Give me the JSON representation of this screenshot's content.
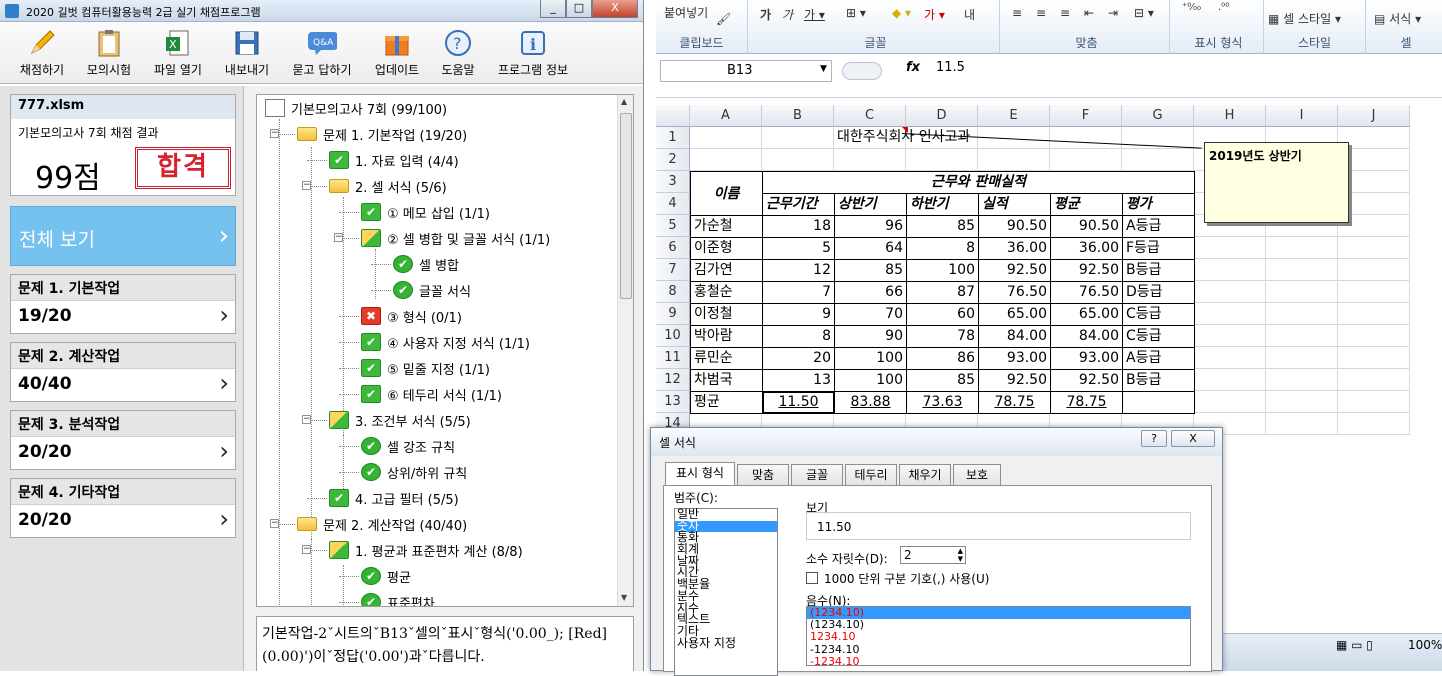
{
  "app": {
    "title": "2020 길벗 컴퓨터활용능력 2급 실기 채점프로그램",
    "window_controls": [
      "_",
      "□",
      "X"
    ],
    "toolbar": [
      {
        "label": "채점하기",
        "icon": "pencil-icon"
      },
      {
        "label": "모의시험",
        "icon": "clipboard-icon"
      },
      {
        "label": "파일 열기",
        "icon": "excel-file-icon"
      },
      {
        "label": "내보내기",
        "icon": "floppy-disk-icon"
      },
      {
        "label": "묻고 답하기",
        "icon": "qa-icon"
      },
      {
        "label": "업데이트",
        "icon": "gift-icon"
      },
      {
        "label": "도움말",
        "icon": "help-icon"
      },
      {
        "label": "프로그램 정보",
        "icon": "info-icon"
      }
    ],
    "result": {
      "file": "777.xlsm",
      "subtitle": "기본모의고사 7회 채점 결과",
      "score": "99점",
      "stamp": "합격"
    },
    "view_all": "전체 보기",
    "questions": [
      {
        "title": "문제 1. 기본작업",
        "score": "19/20"
      },
      {
        "title": "문제 2. 계산작업",
        "score": "40/40"
      },
      {
        "title": "문제 3. 분석작업",
        "score": "20/20"
      },
      {
        "title": "문제 4. 기타작업",
        "score": "20/20"
      }
    ],
    "tree": [
      {
        "label": "기본모의고사 7회 (99/100)",
        "icon": "doc"
      },
      {
        "label": "문제 1. 기본작업 (19/20)",
        "icon": "folder"
      },
      {
        "label": "1. 자료 입력 (4/4)",
        "icon": "ok"
      },
      {
        "label": "2. 셀 서식 (5/6)",
        "icon": "folder"
      },
      {
        "label": "① 메모 삽입 (1/1)",
        "icon": "ok"
      },
      {
        "label": "② 셀 병합 및 글꼴 서식 (1/1)",
        "icon": "okf"
      },
      {
        "label": "셀 병합",
        "icon": "circle"
      },
      {
        "label": "글꼴 서식",
        "icon": "circle"
      },
      {
        "label": "③ 형식 (0/1)",
        "icon": "x"
      },
      {
        "label": "④ 사용자 지정 서식 (1/1)",
        "icon": "ok"
      },
      {
        "label": "⑤ 밑줄 지정 (1/1)",
        "icon": "ok"
      },
      {
        "label": "⑥ 테두리 서식 (1/1)",
        "icon": "ok"
      },
      {
        "label": "3. 조건부 서식 (5/5)",
        "icon": "okf"
      },
      {
        "label": "셀 강조 규칙",
        "icon": "circle"
      },
      {
        "label": "상위/하위 규칙",
        "icon": "circle"
      },
      {
        "label": "4. 고급 필터 (5/5)",
        "icon": "ok"
      },
      {
        "label": "문제 2. 계산작업 (40/40)",
        "icon": "folder"
      },
      {
        "label": "1. 평균과 표준편차 계산 (8/8)",
        "icon": "okf"
      },
      {
        "label": "평균",
        "icon": "circle"
      },
      {
        "label": "표준편차",
        "icon": "circle"
      }
    ],
    "message": "기본작업-2ˇ시트의ˇB13ˇ셀의ˇ표시ˇ형식('0.00_); [Red](0.00)')이ˇ정답('0.00')과ˇ다릅니다."
  },
  "excel": {
    "ribbon": {
      "paste_label": "붙여넣기",
      "groups": [
        "클립보드",
        "글꼴",
        "맞춤",
        "표시 형식",
        "스타일",
        "셀"
      ],
      "cell_style": "셀 스타일",
      "format": "서식"
    },
    "namebox": "B13",
    "fx": "fx",
    "formula": "11.5",
    "columns": [
      "A",
      "B",
      "C",
      "D",
      "E",
      "F",
      "G",
      "H",
      "I",
      "J"
    ],
    "rows": [
      "1",
      "2",
      "3",
      "4",
      "5",
      "6",
      "7",
      "8",
      "9",
      "10",
      "11",
      "12",
      "13",
      "14"
    ],
    "title_cell": "대한주식회사 인사고과",
    "header": {
      "name": "이름",
      "group": "근무와 판매실적",
      "cols": [
        "근무기간",
        "상반기",
        "하반기",
        "실적",
        "평균",
        "평가"
      ]
    },
    "data": [
      [
        "가순철",
        "18",
        "96",
        "85",
        "90.50",
        "90.50",
        "A등급"
      ],
      [
        "이준형",
        "5",
        "64",
        "8",
        "36.00",
        "36.00",
        "F등급"
      ],
      [
        "김가연",
        "12",
        "85",
        "100",
        "92.50",
        "92.50",
        "B등급"
      ],
      [
        "홍철순",
        "7",
        "66",
        "87",
        "76.50",
        "76.50",
        "D등급"
      ],
      [
        "이정철",
        "9",
        "70",
        "60",
        "65.00",
        "65.00",
        "C등급"
      ],
      [
        "박아람",
        "8",
        "90",
        "78",
        "84.00",
        "84.00",
        "C등급"
      ],
      [
        "류민순",
        "20",
        "100",
        "86",
        "93.00",
        "93.00",
        "A등급"
      ],
      [
        "차범국",
        "13",
        "100",
        "85",
        "92.50",
        "92.50",
        "B등급"
      ]
    ],
    "avg_row": [
      "평균",
      "11.50",
      "83.88",
      "73.63",
      "78.75",
      "78.75",
      ""
    ],
    "comment": "2019년도 상반기",
    "zoom": "100%"
  },
  "dialog": {
    "title": "셀 서식",
    "buttons": [
      "?",
      "X"
    ],
    "tabs": [
      "표시 형식",
      "맞춤",
      "글꼴",
      "테두리",
      "채우기",
      "보호"
    ],
    "category_label": "범주(C):",
    "categories": [
      "일반",
      "숫자",
      "통화",
      "회계",
      "날짜",
      "시간",
      "백분율",
      "분수",
      "지수",
      "텍스트",
      "기타",
      "사용자 지정"
    ],
    "selected_category": "숫자",
    "sample_label": "보기",
    "sample_value": "11.50",
    "decimal_label": "소수 자릿수(D):",
    "decimal_value": "2",
    "thousands_label": "1000 단위 구분 기호(,) 사용(U)",
    "negative_label": "음수(N):",
    "negative_options": [
      "(1234.10)",
      "(1234.10)",
      "1234.10",
      "-1234.10",
      "-1234.10"
    ]
  }
}
